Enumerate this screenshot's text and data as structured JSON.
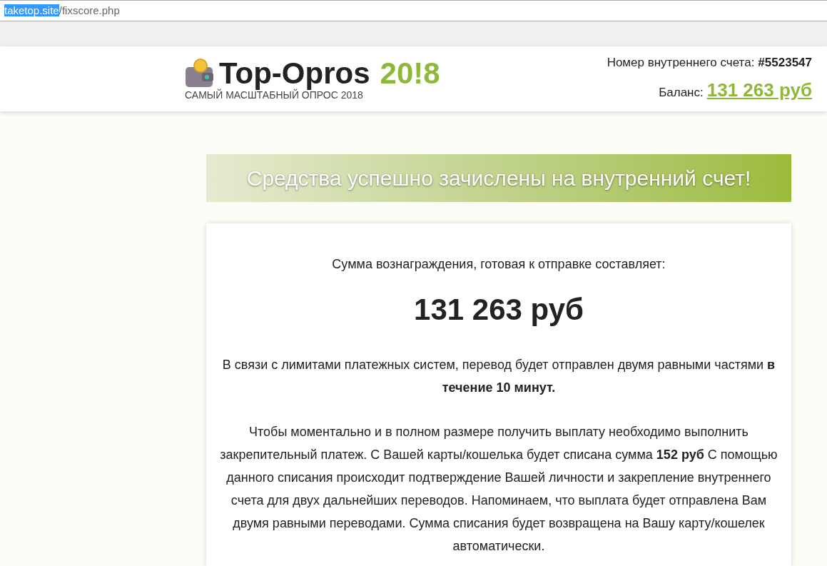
{
  "address_bar": {
    "host": "taketop.site",
    "path": "/fixscore.php",
    "host_selected": true
  },
  "header": {
    "logo_title": "Top-Opros",
    "logo_year": "20!8",
    "tagline": "САМЫЙ МАСШТАБНЫЙ ОПРОС 2018",
    "account_label": "Номер внутреннего счета:",
    "account_number": "#5523547",
    "balance_label": "Баланс:",
    "balance_value": "131 263 руб"
  },
  "banner": "Средства успешно зачислены на внутренний счет!",
  "card": {
    "intro": "Сумма вознаграждения, готовая к отправке составляет:",
    "amount": "131 263 руб",
    "paragraphs": [
      "В связи с лимитами платежных систем, перевод будет отправлен двумя равными частями **в течение 10 минут.**",
      "Чтобы моментально и в полном размере получить выплату необходимо выполнить закрепительный платеж. С Вашей карты/кошелька будет списана сумма **152 руб** С помощью данного списания происходит подтверждение Вашей личности и закрепление внутреннего счета для двух дальнейших переводов. Напоминаем, что выплата будет отправлена Вам двумя равными переводами. Сумма списания будет возвращена на Вашу карту/кошелек автоматически."
    ]
  }
}
